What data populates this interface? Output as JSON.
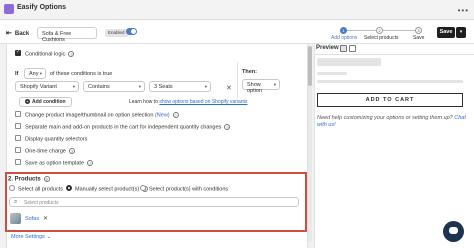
{
  "app": {
    "title": "Easify Options"
  },
  "toolbar": {
    "back_label": "Back",
    "option_name": "Sofa & Free Cushions",
    "enabled_badge": "Enabled",
    "steps": [
      {
        "number": "1",
        "label": "Add options",
        "state": "done"
      },
      {
        "number": "2",
        "label": "Select products",
        "state": "current"
      },
      {
        "number": "3",
        "label": "Save",
        "state": "todo"
      }
    ],
    "save_label": "Save",
    "more_label": "▾"
  },
  "logic": {
    "conditional_label": "Conditional logic",
    "if_label": "If",
    "match_value": "Any",
    "match_suffix": "of these conditions is true",
    "condition": {
      "field": "Shopify Variant",
      "operator": "Contains",
      "value": "3 Seats"
    },
    "then_label": "Then:",
    "then_value": "Show option",
    "add_condition_label": "Add condition",
    "learn_prefix": "Learn how to ",
    "learn_link": "show options based on Shopify variants"
  },
  "settings": [
    {
      "label": "Change product image/thumbnail on option selection",
      "link": "(New)",
      "checked": false
    },
    {
      "label": "Separate main and add-on products in the cart for independent quantity changes",
      "checked": false
    },
    {
      "label": "Display quantity selectors",
      "checked": false
    },
    {
      "label": "One-time charge",
      "checked": false
    },
    {
      "label": "Save as option template",
      "checked": false
    }
  ],
  "products": {
    "title": "2. Products",
    "options": [
      {
        "label": "Select all products",
        "selected": false
      },
      {
        "label": "Manually select product(s)",
        "selected": true
      },
      {
        "label": "Select product(s) with conditions",
        "selected": false
      }
    ],
    "search_placeholder": "Select products",
    "selected_items": [
      {
        "name": "Sofas"
      }
    ]
  },
  "more_settings": "More Settings",
  "preview": {
    "title": "Preview",
    "add_to_cart": "ADD TO CART",
    "help_text": "Need help customizing your options or setting them up? ",
    "help_link": "Chat with us!"
  },
  "colors": {
    "accent": "#4f79c9",
    "highlight_border": "#d14d3f",
    "link": "#2c6ecb",
    "dark_button": "#1f1f1f"
  },
  "icons": [
    "app-icon",
    "back-arrow-icon",
    "help-icon",
    "delete-icon",
    "plus-icon",
    "search-icon",
    "remove-icon",
    "desktop-icon",
    "mobile-icon",
    "chat-icon",
    "chevron-down-icon"
  ]
}
